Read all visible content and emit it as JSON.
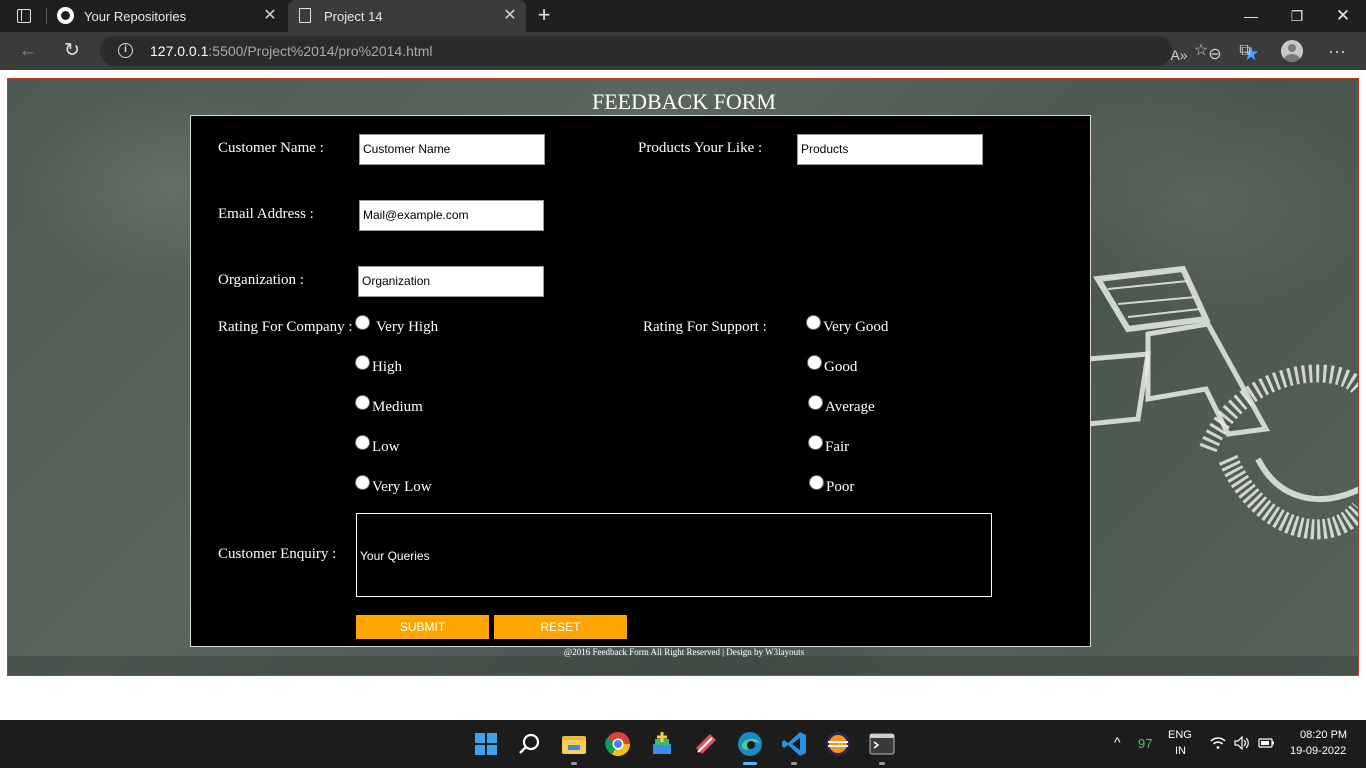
{
  "browser": {
    "tabs": [
      {
        "title": "Your Repositories",
        "close": "✕",
        "icon": "github-icon"
      },
      {
        "title": "Project 14",
        "close": "✕",
        "icon": "page-icon"
      }
    ],
    "new_tab": "+",
    "window_controls": {
      "minimize": "—",
      "maximize": "❐",
      "close": "✕"
    },
    "url_host": "127.0.0.1",
    "url_path": ":5500/Project%2014/pro%2014.html",
    "back": "←",
    "reload": "↻",
    "read_aloud": "A»",
    "zoom": "⊖",
    "favorite": "★",
    "favorites": "☆",
    "collections": "⧉",
    "more": "···"
  },
  "form": {
    "heading": "FEEDBACK FORM",
    "customer_name": {
      "label": "Customer Name :",
      "value": "Customer Name"
    },
    "products": {
      "label": "Products Your Like :",
      "value": "Products"
    },
    "email": {
      "label": "Email Address :",
      "value": "Mail@example.com"
    },
    "organization": {
      "label": "Organization :",
      "value": "Organization"
    },
    "company_rating": {
      "label": "Rating For Company :",
      "options": [
        "Very High",
        "High",
        "Medium",
        "Low",
        "Very Low"
      ]
    },
    "support_rating": {
      "label": "Rating For Support :",
      "options": [
        "Very Good",
        "Good",
        "Average",
        "Fair",
        "Poor"
      ]
    },
    "enquiry": {
      "label": "Customer Enquiry :",
      "placeholder": "Your Queries"
    },
    "submit_label": "SUBMIT",
    "reset_label": "RESET"
  },
  "footer": {
    "text": "@2016 Feedback Form All Right Reserved | Design by W3layouts"
  },
  "taskbar": {
    "weather_value": "97",
    "language": "ENG",
    "region": "IN",
    "time": "08:20 PM",
    "date": "19-09-2022",
    "accent_color": "#ffa500"
  }
}
